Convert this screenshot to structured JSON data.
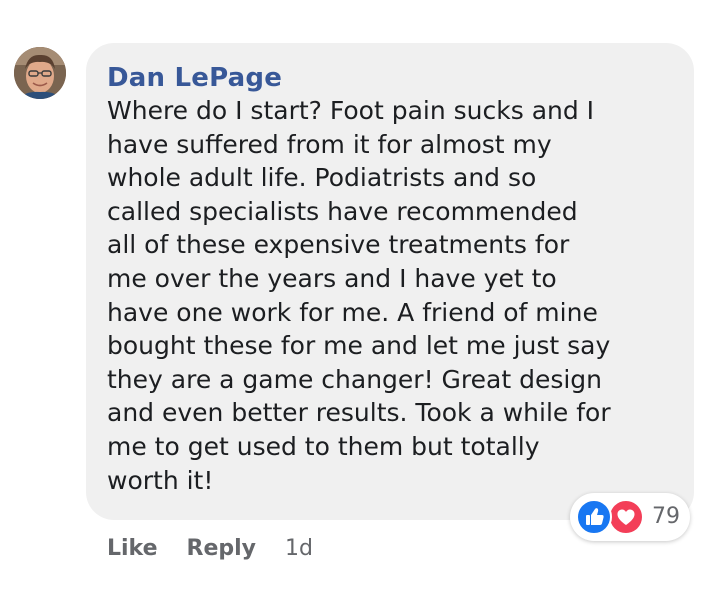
{
  "comment": {
    "author": "Dan LePage",
    "text": "Where do I start? Foot pain sucks and I\nhave suffered from it for almost my\nwhole adult life. Podiatrists and so\ncalled specialists have recommended\nall of these expensive treatments for\nme over the years and I have yet to\nhave one work for me. A friend of mine\nbought these for me and let me just say\nthey are a game changer! Great design\nand even better results. Took a while for\nme to get used to them but totally\nworth it!",
    "reactions": {
      "icons": [
        "like-icon",
        "love-icon"
      ],
      "count": "79",
      "colors": {
        "like": "#1877f2",
        "love": "#f33e58"
      }
    },
    "actions": {
      "like_label": "Like",
      "reply_label": "Reply",
      "timestamp": "1d"
    }
  },
  "colors": {
    "author": "#385898",
    "bubble": "#f0f0f0",
    "meta": "#65676b"
  }
}
